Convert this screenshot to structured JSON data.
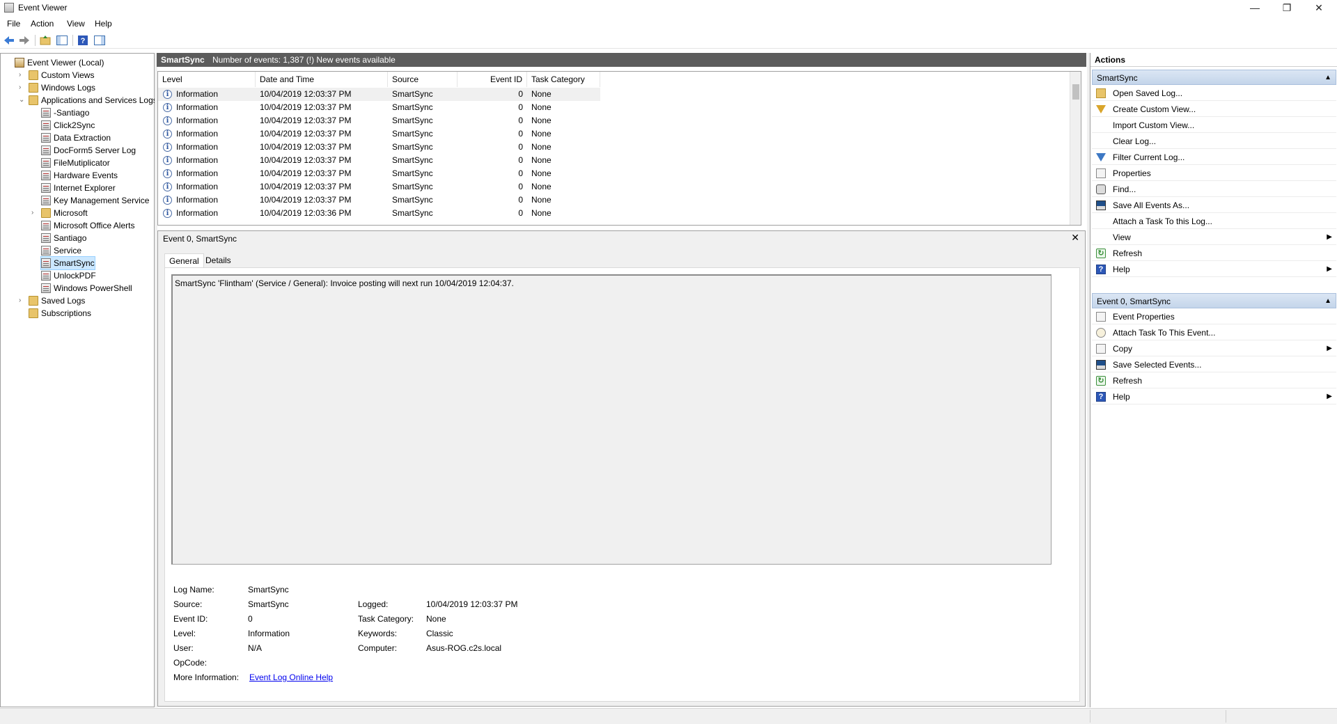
{
  "window": {
    "title": "Event Viewer",
    "controls": {
      "minimize": "—",
      "restore": "❐",
      "close": "✕"
    }
  },
  "menu": [
    "File",
    "Action",
    "View",
    "Help"
  ],
  "toolbar": {
    "icons": [
      "back-icon",
      "forward-icon",
      "up-folder-icon",
      "show-hide-tree-icon",
      "help-icon",
      "show-hide-action-pane-icon"
    ]
  },
  "tree": {
    "items": [
      {
        "label": "Event Viewer (Local)",
        "level": 0,
        "expander": "",
        "icon": "viewer"
      },
      {
        "label": "Custom Views",
        "level": 1,
        "expander": "›",
        "icon": "folder"
      },
      {
        "label": "Windows Logs",
        "level": 1,
        "expander": "›",
        "icon": "folder"
      },
      {
        "label": "Applications and Services Logs",
        "level": 1,
        "expander": "⌄",
        "icon": "folder"
      },
      {
        "label": "-Santiago",
        "level": 2,
        "expander": "",
        "icon": "log"
      },
      {
        "label": "Click2Sync",
        "level": 2,
        "expander": "",
        "icon": "log"
      },
      {
        "label": "Data Extraction",
        "level": 2,
        "expander": "",
        "icon": "log"
      },
      {
        "label": "DocForm5 Server Log",
        "level": 2,
        "expander": "",
        "icon": "log"
      },
      {
        "label": "FileMutiplicator",
        "level": 2,
        "expander": "",
        "icon": "log"
      },
      {
        "label": "Hardware Events",
        "level": 2,
        "expander": "",
        "icon": "log"
      },
      {
        "label": "Internet Explorer",
        "level": 2,
        "expander": "",
        "icon": "log"
      },
      {
        "label": "Key Management Service",
        "level": 2,
        "expander": "",
        "icon": "log"
      },
      {
        "label": "Microsoft",
        "level": 2,
        "expander": "›",
        "icon": "folder"
      },
      {
        "label": "Microsoft Office Alerts",
        "level": 2,
        "expander": "",
        "icon": "log"
      },
      {
        "label": "Santiago",
        "level": 2,
        "expander": "",
        "icon": "log"
      },
      {
        "label": "Service",
        "level": 2,
        "expander": "",
        "icon": "log"
      },
      {
        "label": "SmartSync",
        "level": 2,
        "expander": "",
        "icon": "log",
        "selected": true
      },
      {
        "label": "UnlockPDF",
        "level": 2,
        "expander": "",
        "icon": "log"
      },
      {
        "label": "Windows PowerShell",
        "level": 2,
        "expander": "",
        "icon": "log"
      },
      {
        "label": "Saved Logs",
        "level": 1,
        "expander": "›",
        "icon": "folder"
      },
      {
        "label": "Subscriptions",
        "level": 1,
        "expander": "",
        "icon": "folder"
      }
    ]
  },
  "log_header": {
    "name": "SmartSync",
    "summary": "Number of events: 1,387 (!) New events available"
  },
  "event_list": {
    "columns": [
      "Level",
      "Date and Time",
      "Source",
      "Event ID",
      "Task Category"
    ],
    "rows": [
      [
        "Information",
        "10/04/2019 12:03:37 PM",
        "SmartSync",
        "0",
        "None"
      ],
      [
        "Information",
        "10/04/2019 12:03:37 PM",
        "SmartSync",
        "0",
        "None"
      ],
      [
        "Information",
        "10/04/2019 12:03:37 PM",
        "SmartSync",
        "0",
        "None"
      ],
      [
        "Information",
        "10/04/2019 12:03:37 PM",
        "SmartSync",
        "0",
        "None"
      ],
      [
        "Information",
        "10/04/2019 12:03:37 PM",
        "SmartSync",
        "0",
        "None"
      ],
      [
        "Information",
        "10/04/2019 12:03:37 PM",
        "SmartSync",
        "0",
        "None"
      ],
      [
        "Information",
        "10/04/2019 12:03:37 PM",
        "SmartSync",
        "0",
        "None"
      ],
      [
        "Information",
        "10/04/2019 12:03:37 PM",
        "SmartSync",
        "0",
        "None"
      ],
      [
        "Information",
        "10/04/2019 12:03:37 PM",
        "SmartSync",
        "0",
        "None"
      ],
      [
        "Information",
        "10/04/2019 12:03:36 PM",
        "SmartSync",
        "0",
        "None"
      ]
    ]
  },
  "detail": {
    "title": "Event 0, SmartSync",
    "close": "✕",
    "tabs": [
      "General",
      "Details"
    ],
    "message": "SmartSync 'Flintham' (Service / General): Invoice posting will next run 10/04/2019 12:04:37.",
    "fields": {
      "log_name_label": "Log Name:",
      "log_name": "SmartSync",
      "source_label": "Source:",
      "source": "SmartSync",
      "event_id_label": "Event ID:",
      "event_id": "0",
      "level_label": "Level:",
      "level": "Information",
      "user_label": "User:",
      "user": "N/A",
      "opcode_label": "OpCode:",
      "opcode": "",
      "more_info_label": "More Information:",
      "more_info_link": "Event Log Online Help",
      "logged_label": "Logged:",
      "logged": "10/04/2019 12:03:37 PM",
      "task_category_label": "Task Category:",
      "task_category": "None",
      "keywords_label": "Keywords:",
      "keywords": "Classic",
      "computer_label": "Computer:",
      "computer": "Asus-ROG.c2s.local"
    }
  },
  "actions": {
    "title": "Actions",
    "section1": {
      "title": "SmartSync",
      "items": [
        {
          "label": "Open Saved Log...",
          "icon": "open",
          "arrow": ""
        },
        {
          "label": "Create Custom View...",
          "icon": "filter",
          "arrow": ""
        },
        {
          "label": "Import Custom View...",
          "icon": "none",
          "arrow": ""
        },
        {
          "label": "Clear Log...",
          "icon": "none",
          "arrow": ""
        },
        {
          "label": "Filter Current Log...",
          "icon": "blue-filter",
          "arrow": ""
        },
        {
          "label": "Properties",
          "icon": "props",
          "arrow": ""
        },
        {
          "label": "Find...",
          "icon": "find",
          "arrow": ""
        },
        {
          "label": "Save All Events As...",
          "icon": "save",
          "arrow": ""
        },
        {
          "label": "Attach a Task To this Log...",
          "icon": "none",
          "arrow": ""
        },
        {
          "label": "View",
          "icon": "none",
          "arrow": "▶"
        },
        {
          "label": "Refresh",
          "icon": "refresh",
          "arrow": ""
        },
        {
          "label": "Help",
          "icon": "help",
          "arrow": "▶"
        }
      ]
    },
    "section2": {
      "title": "Event 0, SmartSync",
      "items": [
        {
          "label": "Event Properties",
          "icon": "evprops",
          "arrow": ""
        },
        {
          "label": "Attach Task To This Event...",
          "icon": "task",
          "arrow": ""
        },
        {
          "label": "Copy",
          "icon": "props",
          "arrow": "▶"
        },
        {
          "label": "Save Selected Events...",
          "icon": "save",
          "arrow": ""
        },
        {
          "label": "Refresh",
          "icon": "refresh",
          "arrow": ""
        },
        {
          "label": "Help",
          "icon": "help",
          "arrow": "▶"
        }
      ]
    },
    "collapse_caret": "▲"
  },
  "colors": {
    "header_bar": "#5c5c5c",
    "selection": "#cce8ff",
    "section_header": "#c4d5ea",
    "link": "#0000ee"
  }
}
